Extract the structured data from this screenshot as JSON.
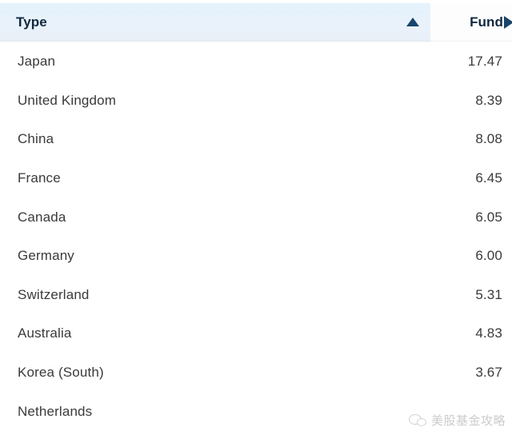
{
  "table": {
    "columns": [
      {
        "key": "type",
        "label": "Type",
        "sort_state": "ascending",
        "sort_icon": "triangle-up-icon",
        "align": "left"
      },
      {
        "key": "fund",
        "label": "Fund",
        "sort_state": "none",
        "sort_icon": "triangle-right-icon",
        "align": "right"
      }
    ],
    "rows": [
      {
        "type": "Japan",
        "fund": "17.47"
      },
      {
        "type": "United Kingdom",
        "fund": "8.39"
      },
      {
        "type": "China",
        "fund": "8.08"
      },
      {
        "type": "France",
        "fund": "6.45"
      },
      {
        "type": "Canada",
        "fund": "6.05"
      },
      {
        "type": "Germany",
        "fund": "6.00"
      },
      {
        "type": "Switzerland",
        "fund": "5.31"
      },
      {
        "type": "Australia",
        "fund": "4.83"
      },
      {
        "type": "Korea (South)",
        "fund": "3.67"
      },
      {
        "type": "Netherlands",
        "fund": ""
      }
    ]
  },
  "watermark": {
    "text": "美股基金攻略",
    "icon": "wechat-icon"
  },
  "colors": {
    "header_background": "#e6f2fb",
    "header_text": "#11283f",
    "sort_arrow": "#18456c",
    "row_text": "#3a3a3c",
    "page_background": "#ffffff"
  }
}
